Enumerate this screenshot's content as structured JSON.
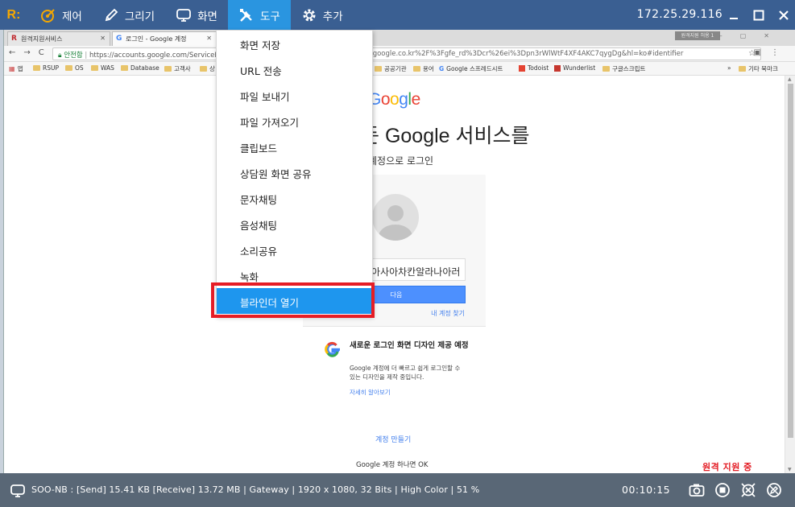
{
  "toolbar": {
    "logo_text": "R:",
    "menu": [
      {
        "label": "제어",
        "icon": "control-icon"
      },
      {
        "label": "그리기",
        "icon": "pen-icon"
      },
      {
        "label": "화면",
        "icon": "monitor-icon"
      },
      {
        "label": "도구",
        "icon": "tools-icon",
        "active": true
      },
      {
        "label": "추가",
        "icon": "gear-icon"
      }
    ],
    "ip": "172.25.29.116",
    "accent": "#2a95e0",
    "bar_color": "#3a5f92"
  },
  "browser": {
    "tabs": [
      {
        "title": "원격지원서비스",
        "favicon": "R"
      },
      {
        "title": "로그인 - Google 계정",
        "favicon": "G"
      }
    ],
    "remote_badge": "원격지원 허용 1",
    "secure_label": "안전함",
    "url_head": "https://accounts.google.com/ServiceL",
    "url_tail": ".google.co.kr%2F%3Fgfe_rd%3Dcr%26ei%3Dpn3rWlWtF4XF4AKC7qygDg&hl=ko#identifier",
    "bookmarks": [
      "앱",
      "RSUP",
      "OS",
      "WAS",
      "Database",
      "고객사",
      "상",
      "공공기관",
      "용어",
      "Google 스프레드시트",
      "Todoist",
      "Wunderlist",
      "구글스크립트"
    ],
    "bookmarks_more": "»",
    "other_bookmarks": "기타 북마크"
  },
  "google_page": {
    "logo": [
      "G",
      "o",
      "o",
      "g",
      "l",
      "e"
    ],
    "headline": "모든 Google 서비스를",
    "subheadline": "계정으로 로그인",
    "input_value": "아사아차칸알라나아러",
    "next_label": "다음",
    "find_account": "내 계정 찾기",
    "promo_title": "새로운 로그인 화면 디자인 제공 예정",
    "promo_body": "Google 계정에 더 빠르고 쉽게 로그인할 수 있는 디자인을 제작 중입니다.",
    "promo_link": "자세히 알아보기",
    "create_account": "계정 만들기",
    "footer": "Google 계정 하나면 OK"
  },
  "dropdown": {
    "items": [
      "화면 저장",
      "URL 전송",
      "파일 보내기",
      "파일 가져오기",
      "클립보드",
      "상담원 화면 공유",
      "문자채팅",
      "음성채팅",
      "소리공유",
      "녹화",
      "블라인더 열기"
    ],
    "highlighted_index": 10,
    "highlight_color": "#1e96ee",
    "callout_color": "#e61d25"
  },
  "remote_status": "원격 지원 중",
  "statusbar": {
    "stats": "SOO-NB : [Send] 15.41 KB  [Receive] 13.72 MB | Gateway | 1920 x 1080, 32 Bits | High Color | 51 %",
    "timer": "00:10:15",
    "icons": [
      "camera-icon",
      "stop-icon",
      "disconnect-icon",
      "pen-off-icon"
    ]
  }
}
